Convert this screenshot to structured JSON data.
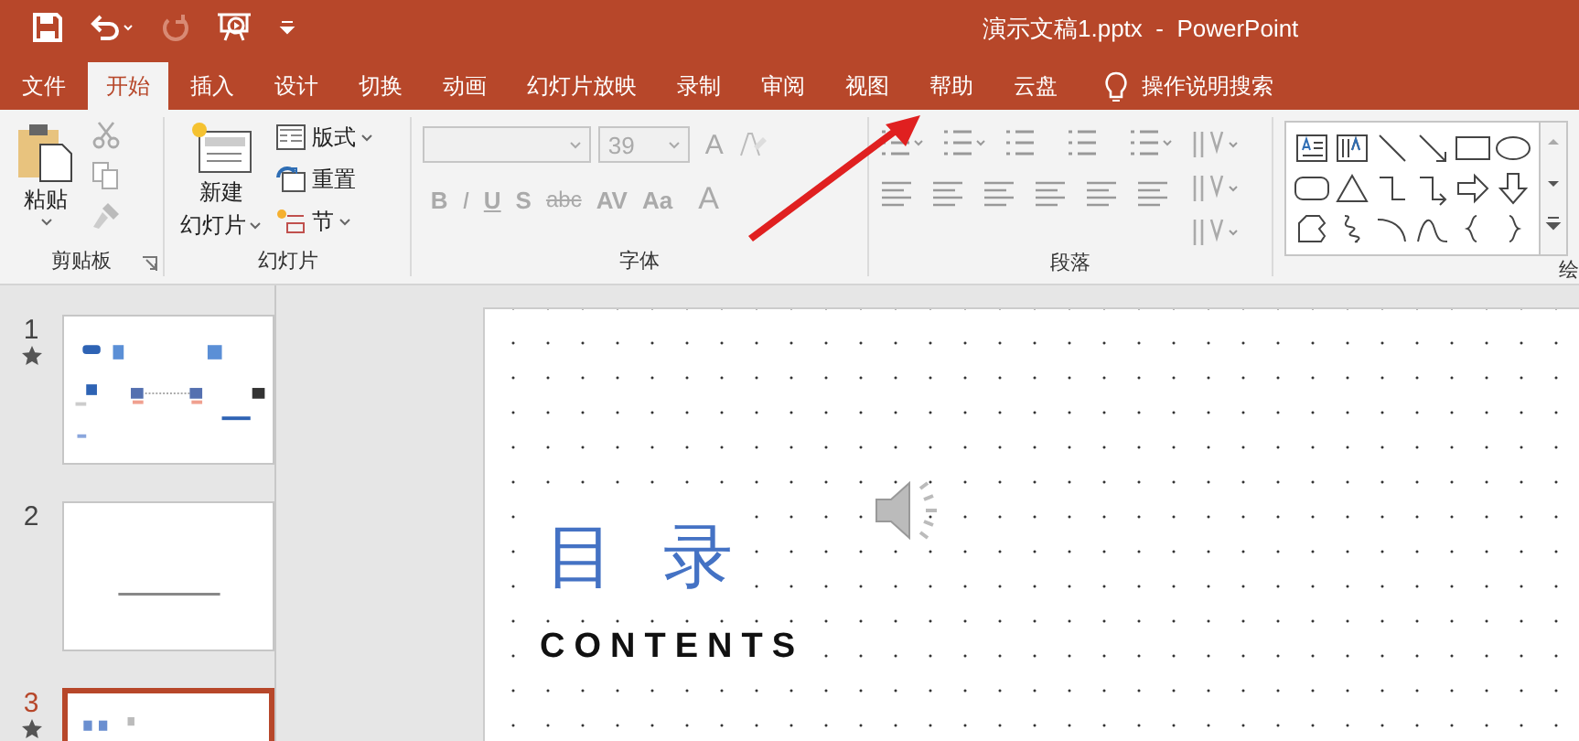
{
  "quick_access": [
    {
      "kind": "save",
      "disabled": false
    },
    {
      "kind": "undo",
      "disabled": false
    },
    {
      "kind": "redo",
      "disabled": true
    },
    {
      "kind": "present",
      "disabled": false
    },
    {
      "kind": "customize",
      "disabled": false
    }
  ],
  "window": {
    "title": "演示文稿1.pptx  -  PowerPoint"
  },
  "tabs": [
    {
      "label": "文件",
      "selected": false
    },
    {
      "label": "开始",
      "selected": true
    },
    {
      "label": "插入",
      "selected": false
    },
    {
      "label": "设计",
      "selected": false
    },
    {
      "label": "切换",
      "selected": false
    },
    {
      "label": "动画",
      "selected": false
    },
    {
      "label": "幻灯片放映",
      "selected": false
    },
    {
      "label": "录制",
      "selected": false
    },
    {
      "label": "审阅",
      "selected": false
    },
    {
      "label": "视图",
      "selected": false
    },
    {
      "label": "帮助",
      "selected": false
    },
    {
      "label": "云盘",
      "selected": false
    }
  ],
  "tell_me": {
    "label": "操作说明搜索"
  },
  "ribbon": {
    "clipboard": {
      "paste": "粘贴",
      "label": "剪贴板"
    },
    "slides": {
      "new_slide": [
        "新建",
        "幻灯片"
      ],
      "layout": "版式",
      "reset": "重置",
      "section": "节",
      "label": "幻灯片"
    },
    "font": {
      "disabled": true,
      "size": "39",
      "grow": "A",
      "format_buttons": [
        "B",
        "I",
        "U",
        "S",
        "abc",
        "AV",
        "Aa"
      ],
      "color_button": "A",
      "label": "字体"
    },
    "paragraph": {
      "label": "段落"
    },
    "drawing": {
      "shapes": [
        {
          "kind": "textbox"
        },
        {
          "kind": "vtextbox"
        },
        {
          "kind": "line"
        },
        {
          "kind": "arrow-line"
        },
        {
          "kind": "rect"
        },
        {
          "kind": "oval"
        },
        {
          "kind": "rounded-rect"
        },
        {
          "kind": "triangle"
        },
        {
          "kind": "elbow"
        },
        {
          "kind": "elbow-arrow"
        },
        {
          "kind": "right-arrow"
        },
        {
          "kind": "down-arrow"
        },
        {
          "kind": "freeform"
        },
        {
          "kind": "scribble"
        },
        {
          "kind": "arc"
        },
        {
          "kind": "curve"
        },
        {
          "kind": "left-brace"
        },
        {
          "kind": "right-brace"
        }
      ],
      "label": "绘"
    }
  },
  "slides": [
    {
      "number": "1",
      "animated": true,
      "selected": false,
      "kind": "toc"
    },
    {
      "number": "2",
      "animated": false,
      "selected": false,
      "kind": "line"
    },
    {
      "number": "3",
      "animated": true,
      "selected": true,
      "kind": "toc-title"
    }
  ],
  "current_slide": {
    "title": "目 录",
    "subtitle": "CONTENTS"
  }
}
